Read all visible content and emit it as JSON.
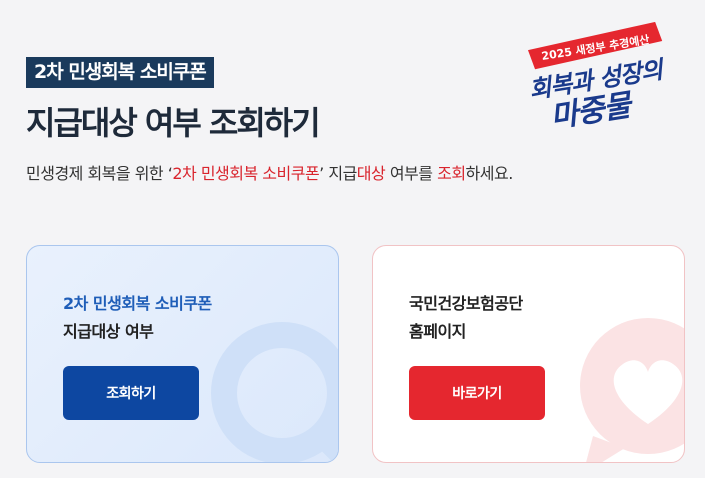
{
  "header": {
    "tag": "2차 민생회복 소비쿠폰",
    "headline": "지급대상 여부 조회하기",
    "subtitle": {
      "part1": "민생경제 회복을 위한 ‘",
      "highlight1": "2차 민생회복 소비쿠폰",
      "part2": "’ 지급",
      "highlight2": "대상",
      "part3": " 여부를 ",
      "highlight3": "조회",
      "part4": "하세요."
    }
  },
  "logo": {
    "line_top": "2025 새정부 추경예산",
    "line1": "회복과 성장의",
    "line2": "마중물"
  },
  "cards": [
    {
      "title_line1": "2차 민생회복 소비쿠폰",
      "title_line2": "지급대상 여부",
      "button_label": "조회하기"
    },
    {
      "title_line1": "국민건강보험공단",
      "title_line2": "홈페이지",
      "button_label": "바로가기"
    }
  ],
  "colors": {
    "navy": "#1a3a5c",
    "accent_red": "#d9242d",
    "button_blue": "#0d47a1",
    "button_red": "#e5272f"
  }
}
